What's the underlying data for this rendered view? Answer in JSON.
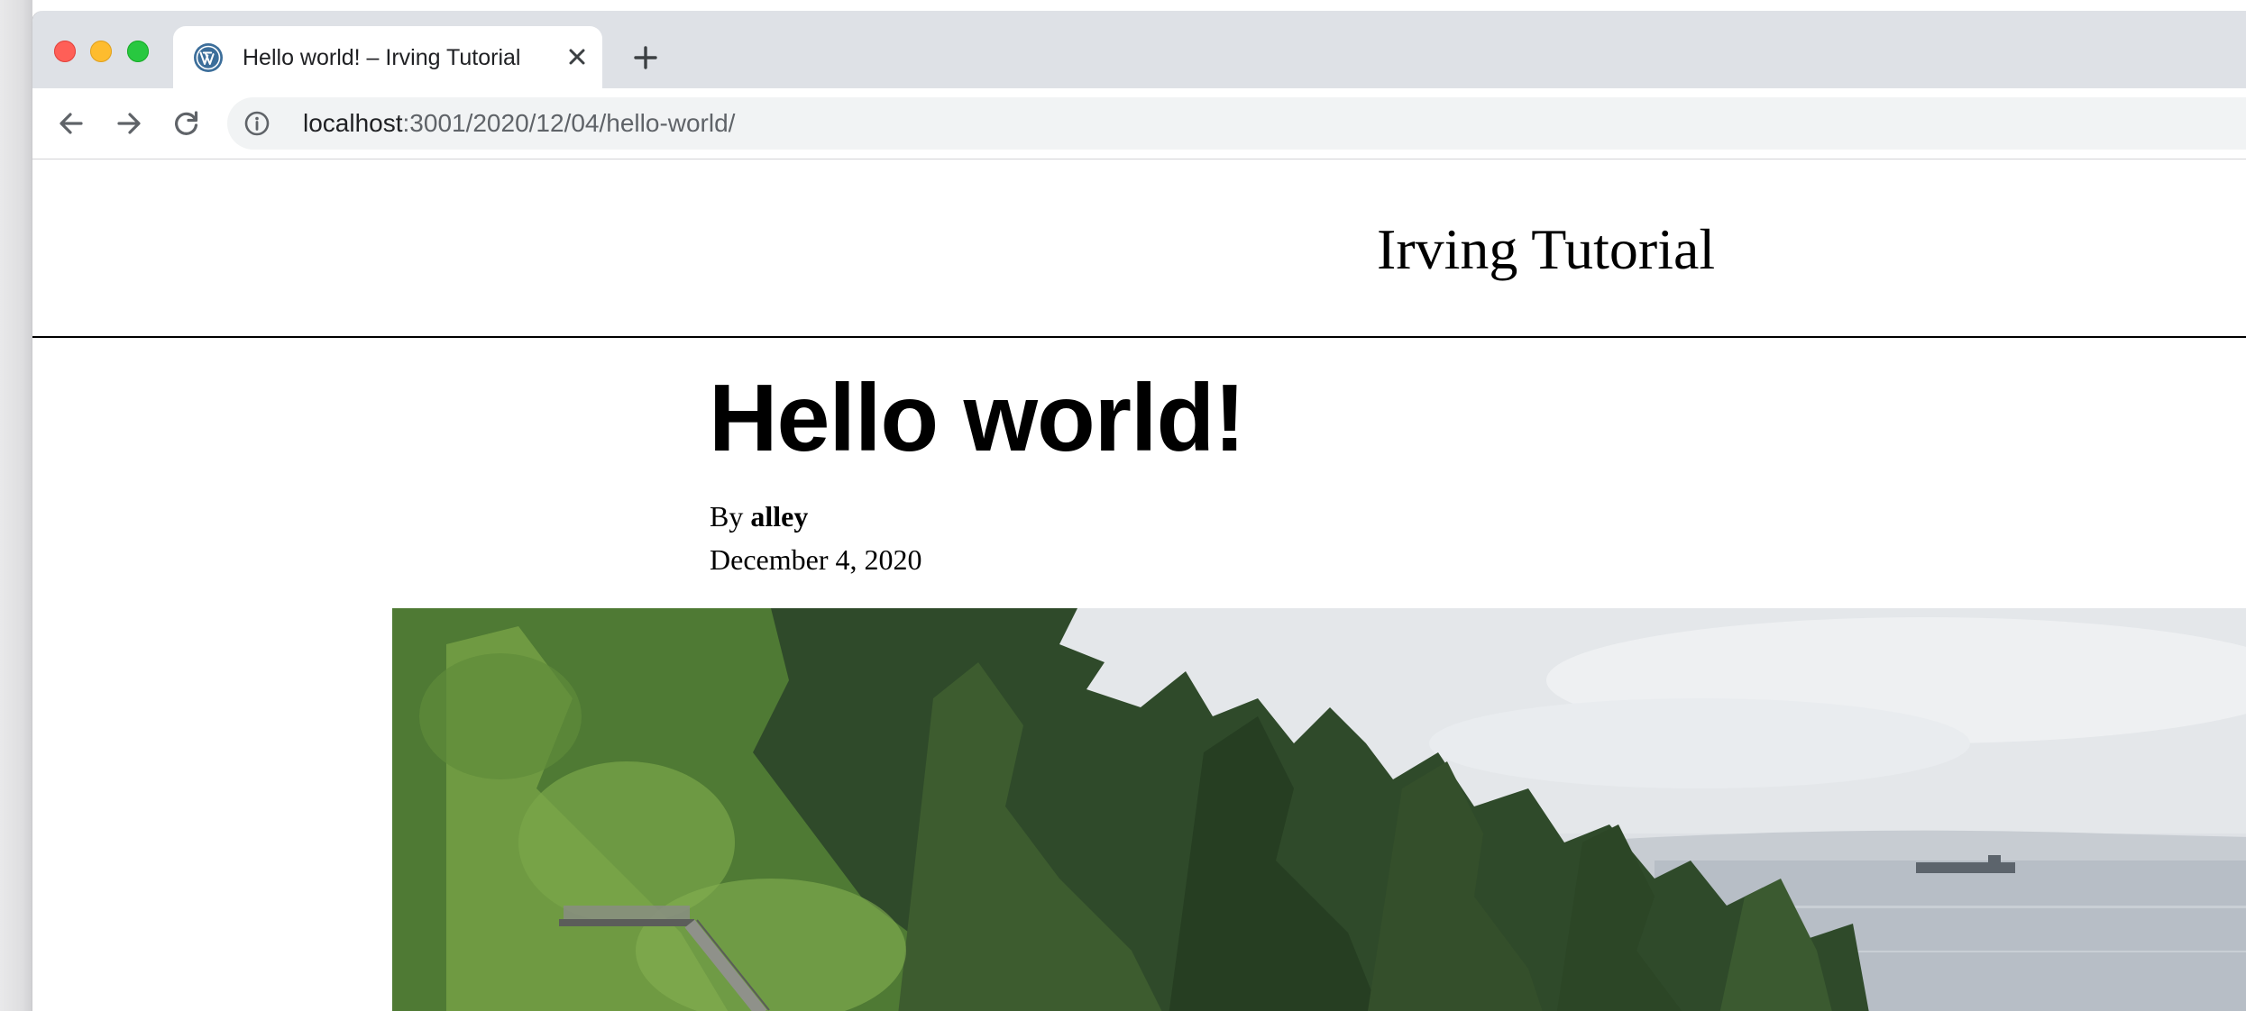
{
  "browser": {
    "tab": {
      "title": "Hello world! – Irving Tutorial",
      "favicon": "wordpress-icon"
    },
    "new_tab_icon": "plus-icon",
    "url": {
      "host": "localhost",
      "path": ":3001/2020/12/04/hello-world/"
    },
    "icons": {
      "back": "arrow-left-icon",
      "forward": "arrow-right-icon",
      "reload": "reload-icon",
      "site_info": "info-icon",
      "close_tab": "close-icon"
    }
  },
  "site": {
    "title": "Irving Tutorial"
  },
  "post": {
    "title": "Hello world!",
    "byline_prefix": "By",
    "author": "alley",
    "date": "December 4, 2020",
    "featured_image": "forest-coastline-image"
  },
  "colors": {
    "tabstrip_bg": "#dee1e6",
    "omnibox_bg": "#f1f3f4",
    "traffic_close": "#ff5f57",
    "traffic_minimize": "#febc2e",
    "traffic_maximize": "#28c840"
  }
}
